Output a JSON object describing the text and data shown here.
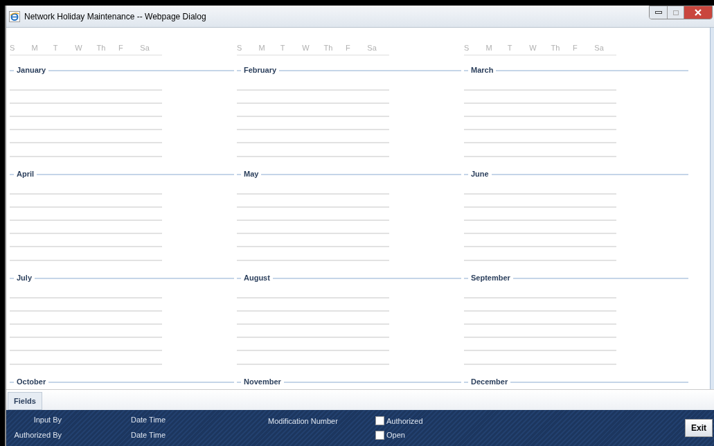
{
  "window": {
    "title": "Network Holiday Maintenance -- Webpage Dialog"
  },
  "calendar": {
    "weekday_rows": [
      [
        "S",
        "M",
        "T",
        "W",
        "Th",
        "F",
        "Sa"
      ],
      [
        "S",
        "M",
        "T",
        "W",
        "Th",
        "F",
        "Sa"
      ],
      [
        "S",
        "M",
        "T",
        "W",
        "Th",
        "F",
        "Sa"
      ]
    ],
    "months": [
      {
        "name": "January"
      },
      {
        "name": "February"
      },
      {
        "name": "March"
      },
      {
        "name": "April"
      },
      {
        "name": "May"
      },
      {
        "name": "June"
      },
      {
        "name": "July"
      },
      {
        "name": "August"
      },
      {
        "name": "September"
      },
      {
        "name": "October"
      },
      {
        "name": "November"
      },
      {
        "name": "December"
      }
    ]
  },
  "tabs": [
    {
      "label": "Fields",
      "selected": true
    }
  ],
  "footer": {
    "fields": [
      {
        "label": "Input By"
      },
      {
        "label": "Date Time"
      },
      {
        "label": "Modification Number"
      },
      {
        "label": "Authorized By"
      },
      {
        "label": "Date Time"
      }
    ],
    "checkboxes": [
      {
        "label": "Authorized",
        "checked": false
      },
      {
        "label": "Open",
        "checked": false
      }
    ],
    "buttons": [
      "Exit"
    ]
  }
}
